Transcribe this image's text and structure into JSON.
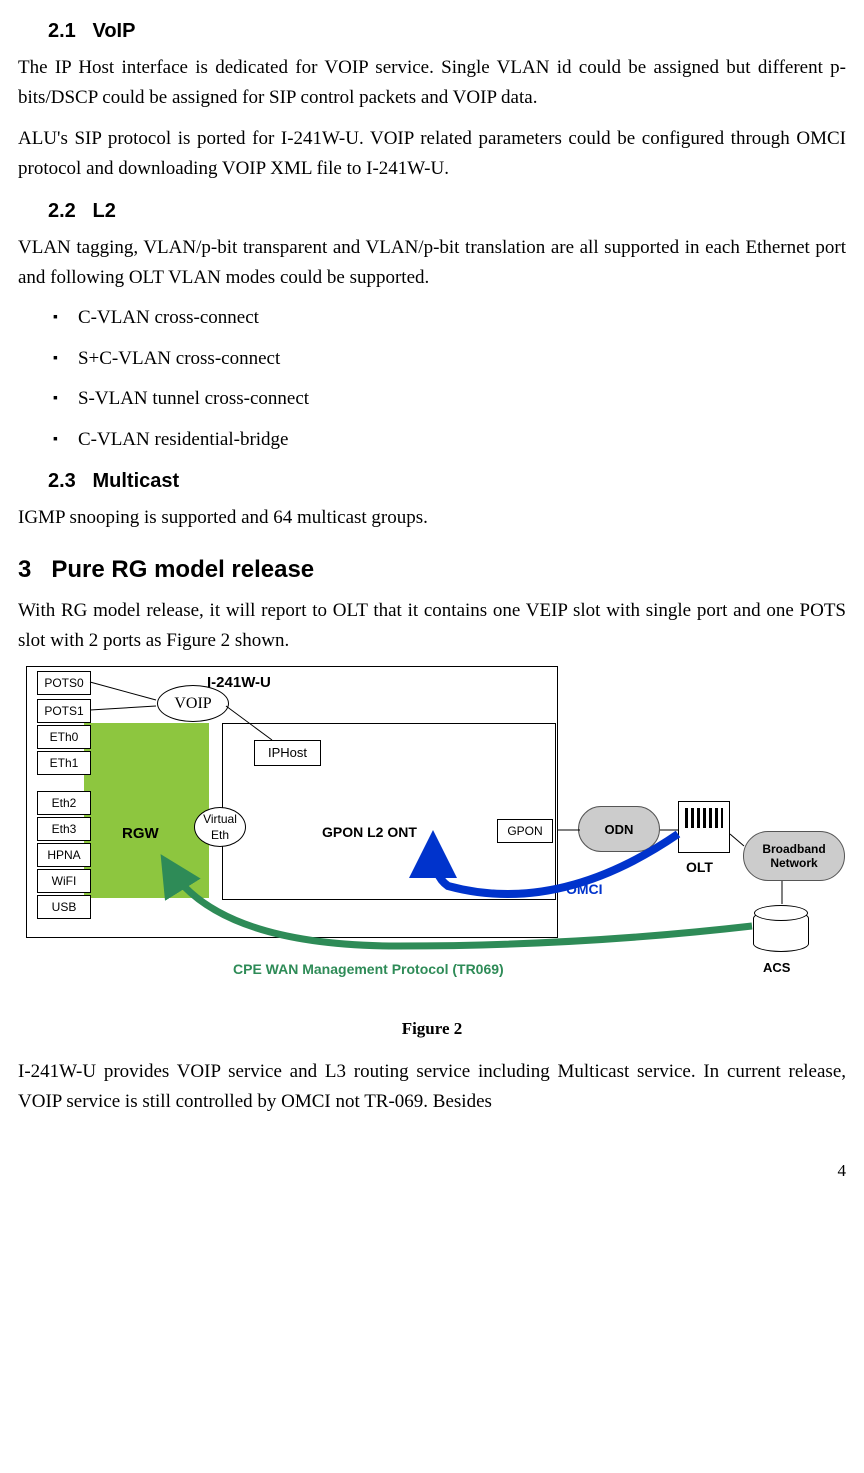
{
  "sections": {
    "s21_num": "2.1",
    "s21_title": "VoIP",
    "s21_p1": "The IP Host interface is dedicated for VOIP service. Single VLAN id could be assigned but different p-bits/DSCP could be assigned for SIP control packets and VOIP data.",
    "s21_p2": "ALU's SIP protocol is ported for I-241W-U. VOIP related parameters could be configured through OMCI protocol and downloading VOIP XML file to I-241W-U.",
    "s22_num": "2.2",
    "s22_title": "L2",
    "s22_p1": "VLAN tagging, VLAN/p-bit transparent and VLAN/p-bit translation are all supported in each Ethernet port and following OLT VLAN modes could be supported.",
    "s22_bullets": [
      "C-VLAN cross-connect",
      "S+C-VLAN cross-connect",
      "S-VLAN tunnel cross-connect",
      "C-VLAN residential-bridge"
    ],
    "s23_num": "2.3",
    "s23_title": "Multicast",
    "s23_p1": "IGMP snooping is supported and 64 multicast groups.",
    "s3_num": "3",
    "s3_title": "Pure RG model release",
    "s3_p1": "With RG model release, it will report to OLT that it contains one VEIP slot with single port and one POTS slot with 2 ports as Figure 2 shown.",
    "s3_p2": "I-241W-U provides VOIP service and L3 routing service including Multicast service. In current release, VOIP service is still controlled by OMCI not TR-069. Besides"
  },
  "figure": {
    "caption": "Figure 2",
    "device": "I-241W-U",
    "rgw": "RGW",
    "gpon_l2": "GPON L2 ONT",
    "voip": "VOIP",
    "iphost": "IPHost",
    "virtualeth_l1": "Virtual",
    "virtualeth_l2": "Eth",
    "gpon_port": "GPON",
    "odn": "ODN",
    "olt": "OLT",
    "broadband_l1": "Broadband",
    "broadband_l2": "Network",
    "acs": "ACS",
    "omci": "OMCI",
    "cpe": "CPE WAN Management Protocol (TR069)",
    "ports": [
      "POTS0",
      "POTS1",
      "ETh0",
      "ETh1",
      "Eth2",
      "Eth3",
      "HPNA",
      "WiFI",
      "USB"
    ]
  },
  "page_num": "4"
}
